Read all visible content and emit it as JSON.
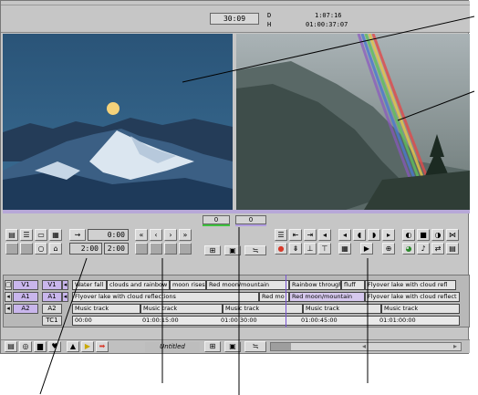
{
  "app": {
    "timecode_display": "30:09",
    "d_label": "D",
    "h_label": "H",
    "duration": "1:07:16",
    "master_tc": "01:00:37:07"
  },
  "source_position": "0",
  "record_position": "0",
  "mark_fields": {
    "row1_right": "0:00",
    "row2_left": "2:00",
    "row2_right": "2:00"
  },
  "colors": {
    "position_bar_source": "#3fc23f",
    "position_bar_record": "#b09ce0",
    "playhead": "#7a55d0",
    "record_button": "#d83a2a"
  },
  "tracks": {
    "record": [
      {
        "label": "V1"
      },
      {
        "label": "A1"
      },
      {
        "label": "A2"
      }
    ],
    "source": [
      {
        "label": "V1"
      },
      {
        "label": "A1"
      },
      {
        "label": "A2"
      },
      {
        "label": "TC1"
      }
    ]
  },
  "timeline": {
    "v1_clips": [
      "Water fall",
      "clouds and rainbow",
      "moon rises",
      "Red moon/mountain",
      "Rainbow through",
      "fluff",
      "Flyover lake with cloud refl"
    ],
    "a1_clips": [
      "Flyover lake with cloud reflections",
      "Red mo",
      "Red moon/mountain",
      "Flyover lake with cloud reflect"
    ],
    "a2_clips": [
      "Music track",
      "Music track",
      "Music track",
      "Music track",
      "Music track"
    ],
    "tc_marks": [
      "00:00",
      "01:00:15:00",
      "01:00:30:00",
      "01:00:45:00",
      "01:01:00:00"
    ]
  },
  "sequence_name": "Untitled",
  "icons": [
    "rewind-icon",
    "step-back-icon",
    "step-forward-icon",
    "fast-forward-icon",
    "play-icon",
    "record-icon",
    "mark-in-icon",
    "mark-out-icon",
    "lift-icon",
    "extract-icon",
    "splice-icon",
    "overwrite-icon",
    "audio-icon"
  ]
}
